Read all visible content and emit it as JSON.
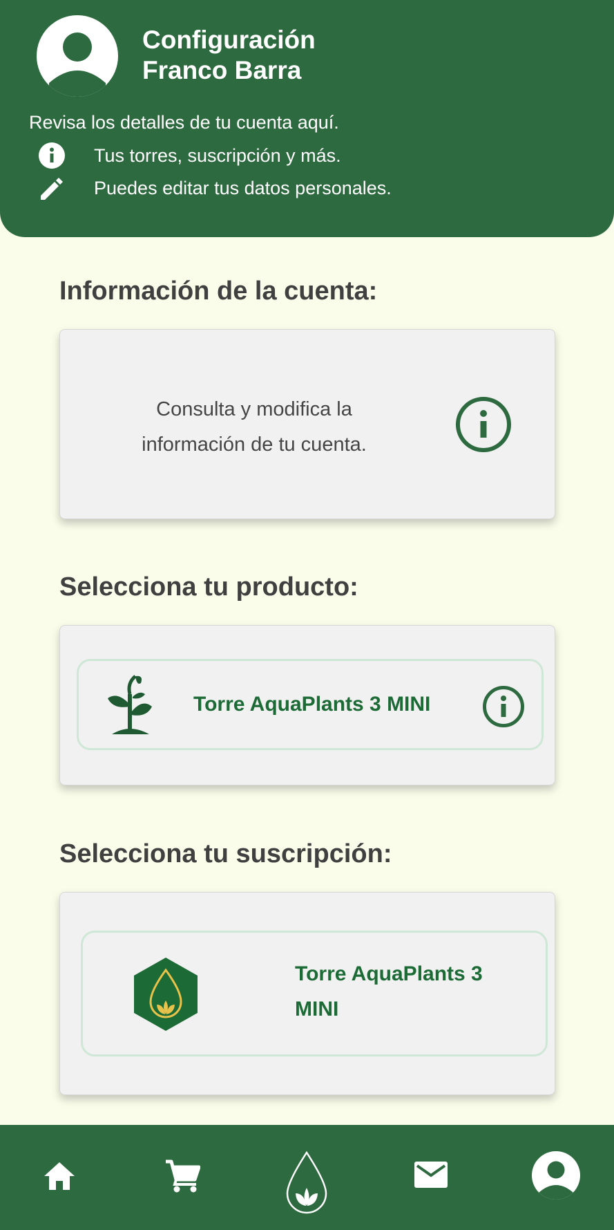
{
  "header": {
    "title_line1": "Configuración",
    "title_line2": "Franco Barra",
    "subtitle": "Revisa los detalles de tu cuenta aquí.",
    "row1": "Tus torres, suscripción y más.",
    "row2": "Puedes editar tus datos personales."
  },
  "account": {
    "section_title": "Información de la cuenta:",
    "card_text": "Consulta y modifica la información de tu cuenta."
  },
  "product": {
    "section_title": "Selecciona tu producto:",
    "name": "Torre AquaPlants 3 MINI"
  },
  "subscription": {
    "section_title": "Selecciona tu suscripción:",
    "name": "Torre AquaPlants 3 MINI"
  },
  "nav": {
    "items": [
      "home-icon",
      "cart-icon",
      "drop-leaf-icon",
      "mail-icon",
      "profile-icon"
    ]
  },
  "colors": {
    "primary": "#2d6a3f",
    "background": "#fbfdeb",
    "card": "#f1f1f1",
    "product_text": "#1c6a35",
    "badge_gold": "#e8c24a"
  }
}
